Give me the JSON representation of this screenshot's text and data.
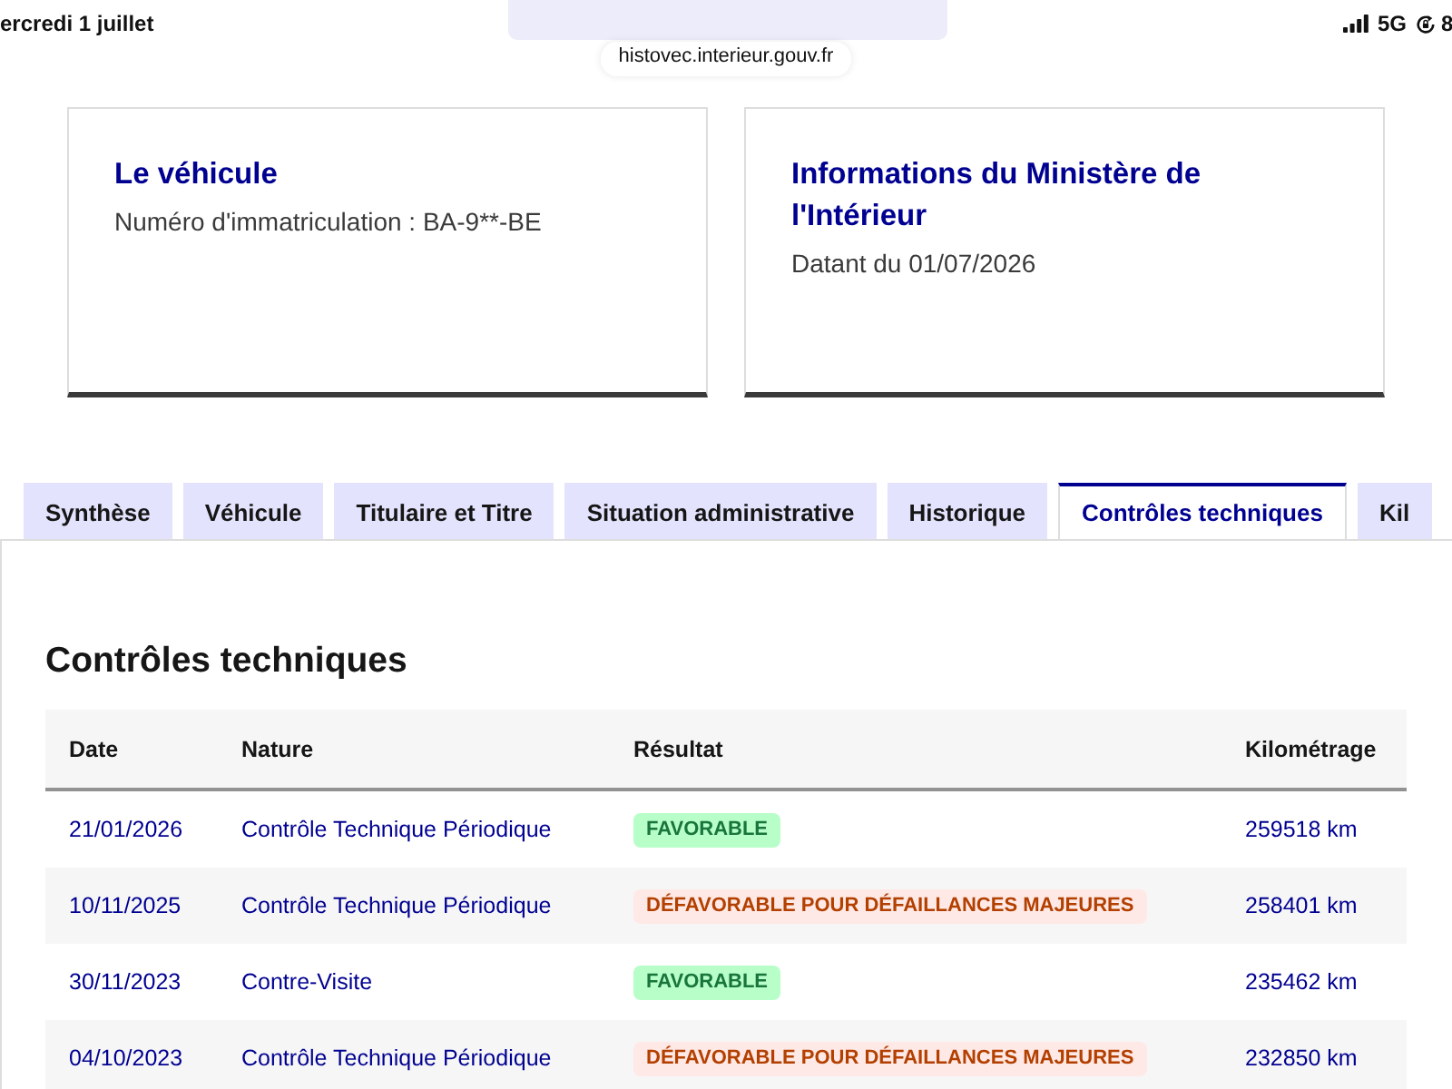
{
  "status_bar": {
    "time": "ercredi 1 juillet",
    "network": "5G",
    "battery": "8"
  },
  "address_bar": {
    "url": "histovec.interieur.gouv.fr"
  },
  "cards": [
    {
      "title": "Le véhicule",
      "text": "Numéro d'immatriculation : BA-9**-BE"
    },
    {
      "title": "Informations du Ministère de l'Intérieur",
      "text": "Datant du 01/07/2026"
    }
  ],
  "tabs": [
    {
      "label": "Synthèse",
      "selected": false
    },
    {
      "label": "Véhicule",
      "selected": false
    },
    {
      "label": "Titulaire et Titre",
      "selected": false
    },
    {
      "label": "Situation administrative",
      "selected": false
    },
    {
      "label": "Historique",
      "selected": false
    },
    {
      "label": "Contrôles techniques",
      "selected": true
    },
    {
      "label": "Kil",
      "selected": false
    }
  ],
  "section": {
    "title": "Contrôles techniques"
  },
  "table": {
    "columns": [
      "Date",
      "Nature",
      "Résultat",
      "Kilométrage"
    ],
    "rows": [
      {
        "date": "21/01/2026",
        "nature": "Contrôle Technique Périodique",
        "result": {
          "label": "FAVORABLE",
          "kind": "success"
        },
        "mileage": "259518 km"
      },
      {
        "date": "10/11/2025",
        "nature": "Contrôle Technique Périodique",
        "result": {
          "label": "DÉFAVORABLE POUR DÉFAILLANCES MAJEURES",
          "kind": "error"
        },
        "mileage": "258401 km"
      },
      {
        "date": "30/11/2023",
        "nature": "Contre-Visite",
        "result": {
          "label": "FAVORABLE",
          "kind": "success"
        },
        "mileage": "235462 km"
      },
      {
        "date": "04/10/2023",
        "nature": "Contrôle Technique Périodique",
        "result": {
          "label": "DÉFAVORABLE POUR DÉFAILLANCES MAJEURES",
          "kind": "error"
        },
        "mileage": "232850 km"
      }
    ]
  }
}
